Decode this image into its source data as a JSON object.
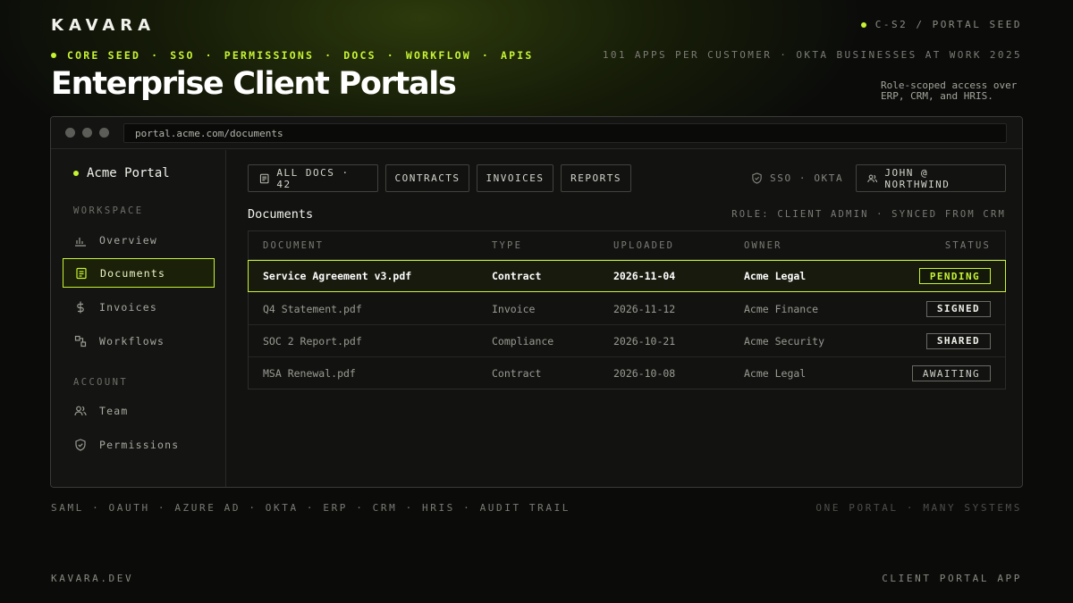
{
  "brand": "KAVARA",
  "header": {
    "slide_code": "C-S2 / PORTAL SEED",
    "tags": [
      "CORE SEED",
      "SSO",
      "PERMISSIONS",
      "DOCS",
      "WORKFLOW",
      "APIS"
    ],
    "tag_separator": "·",
    "stat": "101 APPS PER CUSTOMER · OKTA BUSINESSES AT WORK 2025",
    "title": "Enterprise Client Portals",
    "subtitle": "Role-scoped access over ERP, CRM, and HRIS."
  },
  "browser": {
    "url": "portal.acme.com/documents"
  },
  "sidebar": {
    "app_name": "Acme Portal",
    "workspace_label": "WORKSPACE",
    "account_label": "ACCOUNT",
    "items": [
      {
        "label": "Overview",
        "icon": "bar-chart-icon"
      },
      {
        "label": "Documents",
        "icon": "document-icon",
        "active": true
      },
      {
        "label": "Invoices",
        "icon": "dollar-icon"
      },
      {
        "label": "Workflows",
        "icon": "workflow-icon"
      },
      {
        "label": "Team",
        "icon": "users-icon"
      },
      {
        "label": "Permissions",
        "icon": "shield-icon"
      }
    ]
  },
  "toolbar": {
    "filters": [
      "ALL DOCS · 42",
      "CONTRACTS",
      "INVOICES",
      "REPORTS"
    ],
    "sso_label": "SSO · OKTA",
    "user_label": "JOHN @ NORTHWIND"
  },
  "documents": {
    "title": "Documents",
    "role_info": "ROLE: CLIENT ADMIN · SYNCED FROM CRM",
    "columns": [
      "DOCUMENT",
      "TYPE",
      "UPLOADED",
      "OWNER",
      "STATUS"
    ],
    "rows": [
      {
        "name": "Service Agreement v3.pdf",
        "type": "Contract",
        "uploaded": "2026-11-04",
        "owner": "Acme Legal",
        "status": "PENDING"
      },
      {
        "name": "Q4 Statement.pdf",
        "type": "Invoice",
        "uploaded": "2026-11-12",
        "owner": "Acme Finance",
        "status": "SIGNED"
      },
      {
        "name": "SOC 2 Report.pdf",
        "type": "Compliance",
        "uploaded": "2026-10-21",
        "owner": "Acme Security",
        "status": "SHARED"
      },
      {
        "name": "MSA Renewal.pdf",
        "type": "Contract",
        "uploaded": "2026-10-08",
        "owner": "Acme Legal",
        "status": "AWAITING"
      }
    ]
  },
  "footer": {
    "integrations": "SAML · OAUTH · AZURE AD · OKTA · ERP · CRM · HRIS · AUDIT TRAIL",
    "tagline": "ONE PORTAL · MANY SYSTEMS",
    "site": "KAVARA.DEV",
    "label": "CLIENT PORTAL APP"
  },
  "colors": {
    "accent": "#c6f432",
    "background": "#0b0c0a"
  }
}
